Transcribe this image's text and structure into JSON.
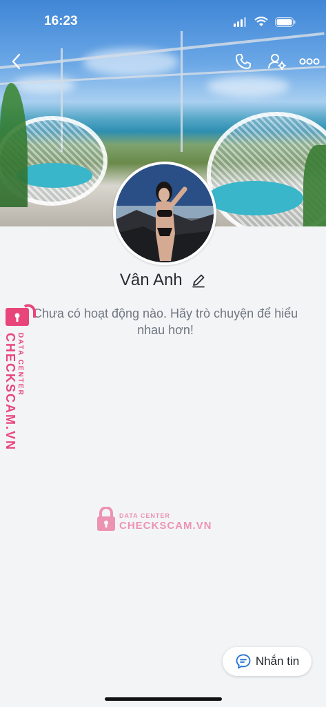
{
  "status_bar": {
    "time": "16:23"
  },
  "profile": {
    "name": "Vân Anh"
  },
  "feed": {
    "empty_message": "Chưa có hoạt động nào. Hãy trò chuyện để hiểu nhau hơn!"
  },
  "actions": {
    "message_label": "Nhắn tin"
  },
  "watermark": {
    "small": "DATA CENTER",
    "big": "CHECKSCAM.VN"
  },
  "colors": {
    "accent": "#1f6fd6",
    "watermark": "#e8457a"
  }
}
